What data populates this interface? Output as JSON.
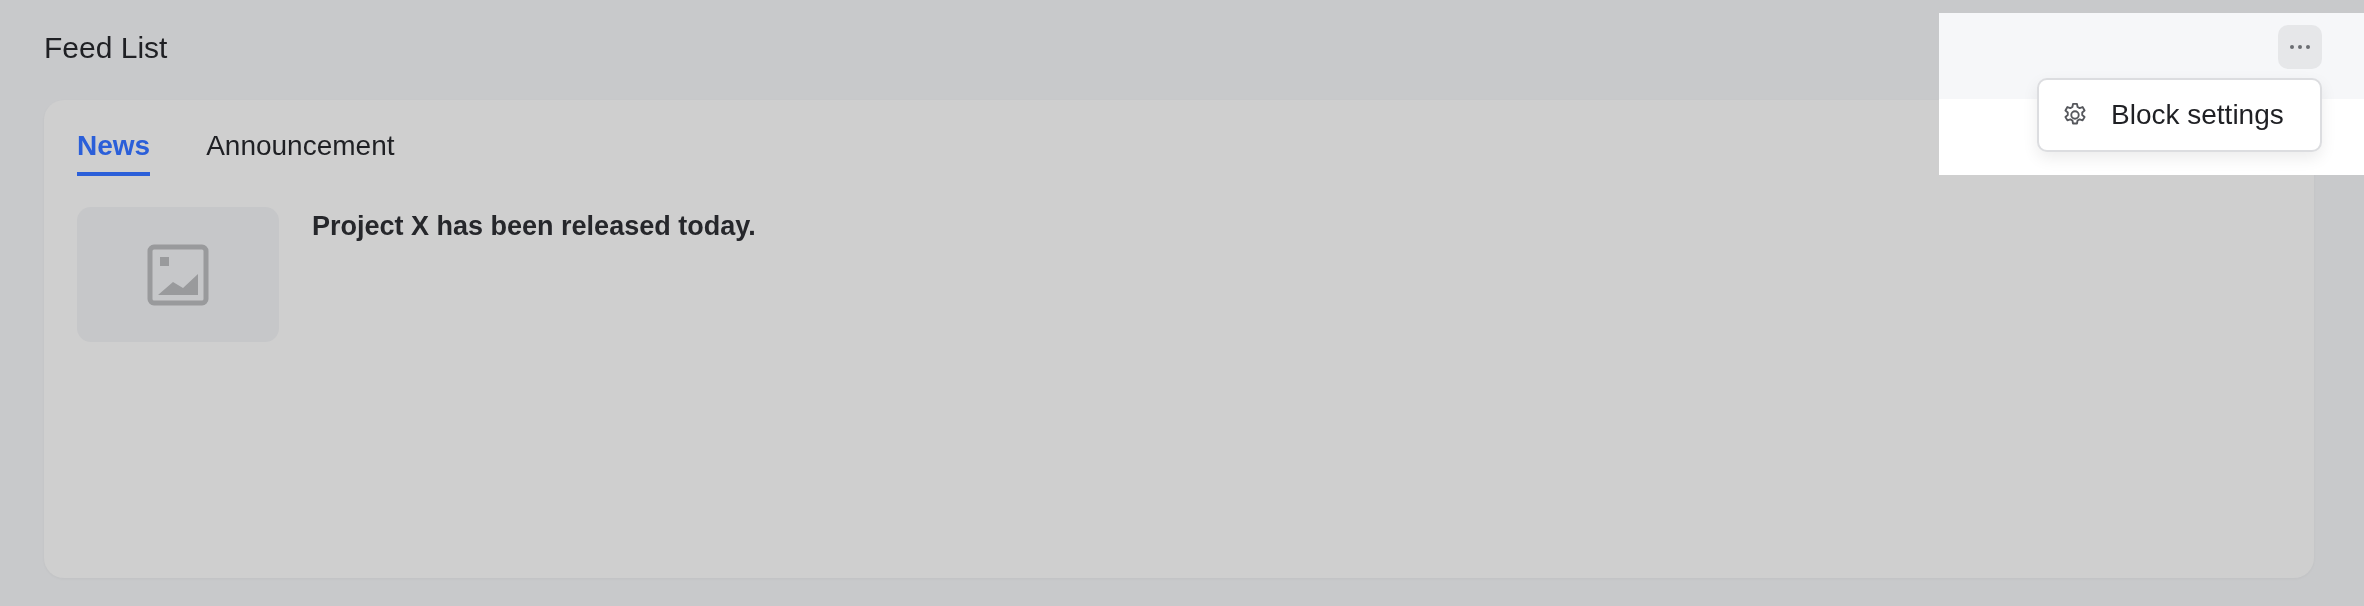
{
  "block": {
    "title": "Feed List",
    "tabs": [
      {
        "label": "News",
        "selected": true
      },
      {
        "label": "Announcement",
        "selected": false
      }
    ],
    "items": [
      {
        "title": "Project X has been released today."
      }
    ]
  },
  "menu": {
    "items": [
      {
        "label": "Block settings"
      }
    ]
  }
}
